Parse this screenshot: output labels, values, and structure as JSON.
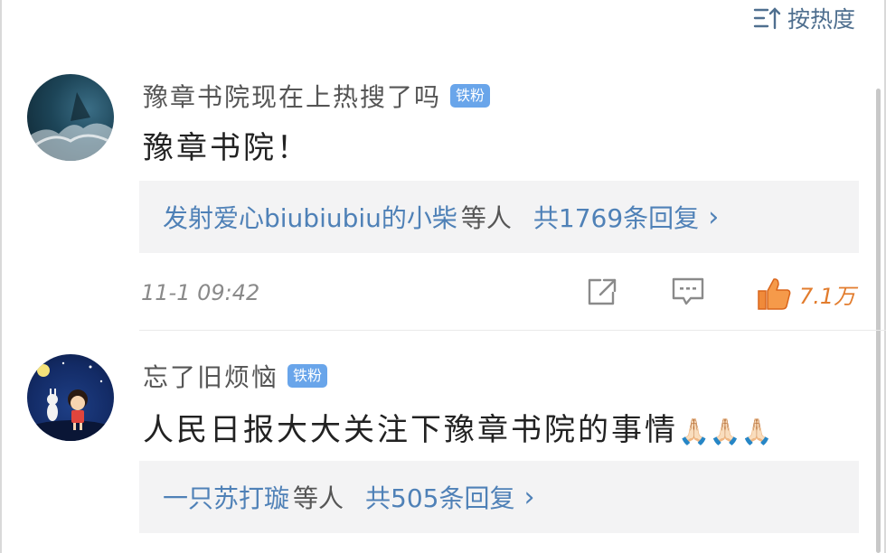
{
  "sort": {
    "label": "按热度",
    "icon": "sort-desc-icon"
  },
  "comments": [
    {
      "username": "豫章书院现在上热搜了吗",
      "badge": "铁粉",
      "text": "豫章书院！",
      "reply": {
        "names": "发射爱心biubiubiu的小柴",
        "etc": "等人",
        "count": "共1769条回复",
        "chevron": "›"
      },
      "timestamp": "11-1 09:42",
      "likes": "7.1万",
      "icons": [
        "share-icon",
        "comment-icon",
        "like-icon"
      ]
    },
    {
      "username": "忘了旧烦恼",
      "badge": "铁粉",
      "text": "人民日报大大关注下豫章书院的事情",
      "emoji": "🙏🏻🙏🏻🙏🏻",
      "reply": {
        "names": "一只苏打璇",
        "etc": "等人",
        "count": "共505条回复",
        "chevron": "›"
      }
    }
  ],
  "colors": {
    "link": "#4f81b7",
    "like": "#e27c2d",
    "badge": "#69a5ea",
    "reply_bg": "#f3f3f4"
  }
}
